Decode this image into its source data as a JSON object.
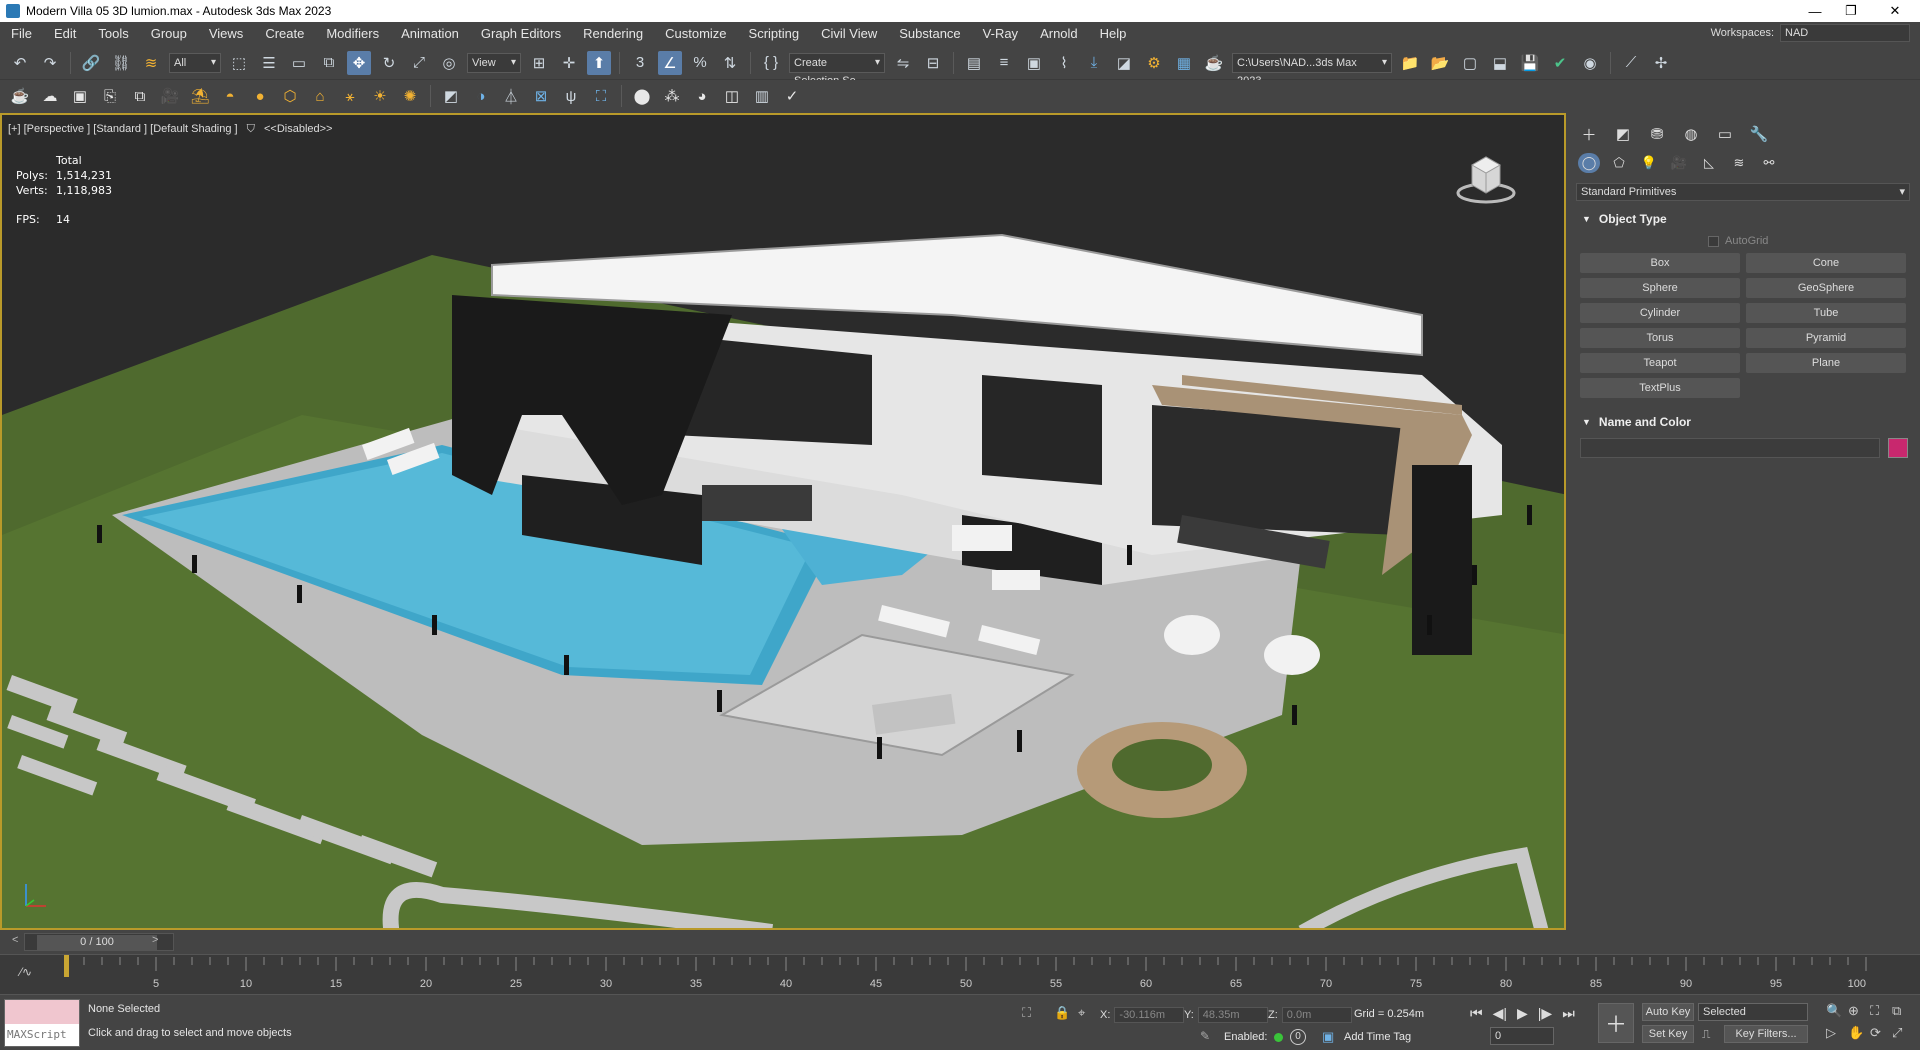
{
  "window": {
    "title": "Modern Villa 05 3D lumion.max - Autodesk 3ds Max 2023"
  },
  "menu": [
    "File",
    "Edit",
    "Tools",
    "Group",
    "Views",
    "Create",
    "Modifiers",
    "Animation",
    "Graph Editors",
    "Rendering",
    "Customize",
    "Scripting",
    "Civil View",
    "Substance",
    "V-Ray",
    "Arnold",
    "Help"
  ],
  "workspaces": {
    "label": "Workspaces:",
    "value": "NAD"
  },
  "toolbar": {
    "selection_filter": "All",
    "ref_coord": "View",
    "named_selection": "Create Selection Se",
    "project_path": "C:\\Users\\NAD...3ds Max 2023"
  },
  "viewport": {
    "label": "[+] [Perspective ] [Standard ] [Default Shading ]",
    "disabled": "<<Disabled>>",
    "stats": {
      "total_label": "Total",
      "polys_label": "Polys:",
      "polys": "1,514,231",
      "verts_label": "Verts:",
      "verts": "1,118,983",
      "fps_label": "FPS:",
      "fps": "14"
    }
  },
  "command_panel": {
    "category": "Standard Primitives",
    "object_type_title": "Object Type",
    "autogrid": "AutoGrid",
    "primitives": [
      "Box",
      "Cone",
      "Sphere",
      "GeoSphere",
      "Cylinder",
      "Tube",
      "Torus",
      "Pyramid",
      "Teapot",
      "Plane",
      "TextPlus"
    ],
    "name_color_title": "Name and Color",
    "color": "#c8286e"
  },
  "timeline": {
    "frame": "0 / 100",
    "ticks": [
      "5",
      "10",
      "15",
      "20",
      "25",
      "30",
      "35",
      "40",
      "45",
      "50",
      "55",
      "60",
      "65",
      "70",
      "75",
      "80",
      "85",
      "90",
      "95",
      "100"
    ]
  },
  "status": {
    "maxscript": "MAXScript",
    "selection": "None Selected",
    "prompt": "Click and drag to select and move objects",
    "x_label": "X:",
    "x": "-30.116m",
    "y_label": "Y:",
    "y": "48.35m",
    "z_label": "Z:",
    "z": "0.0m",
    "grid": "Grid = 0.254m",
    "enabled_label": "Enabled:",
    "enabled_value": "0",
    "add_time_tag": "Add Time Tag",
    "auto_key": "Auto Key",
    "key_mode": "Selected",
    "set_key": "Set Key",
    "key_filters": "Key Filters...",
    "frame_field": "0"
  }
}
